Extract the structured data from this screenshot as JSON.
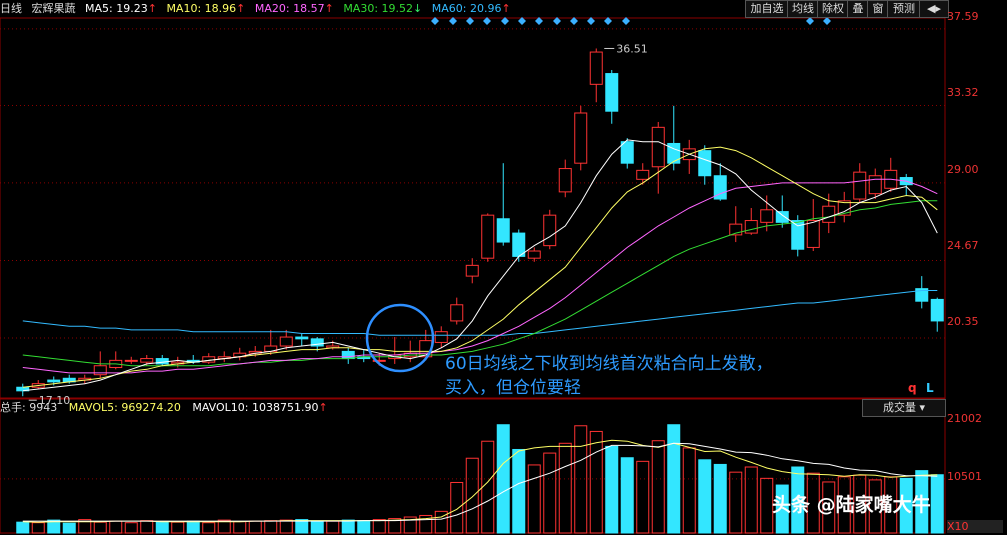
{
  "header": {
    "period": "日线",
    "stock_name": "宏辉果蔬",
    "ma5": {
      "label": "MA5: 19.23",
      "color": "#ffffff"
    },
    "ma10": {
      "label": "MA10: 18.96",
      "color": "#ffff66"
    },
    "ma20": {
      "label": "MA20: 18.57",
      "color": "#ff66ff"
    },
    "ma30": {
      "label": "MA30: 19.52",
      "color": "#33dd33"
    },
    "ma60": {
      "label": "MA60: 20.96",
      "color": "#33bbff"
    },
    "arrow_up": "↑",
    "arrow_down": "↓"
  },
  "toolbar": {
    "add_watch": "加自选",
    "ma": "均线",
    "adjust": "除权",
    "overlay": "叠",
    "window": "窗",
    "forecast": "预测",
    "menu_arrow": "◀▸"
  },
  "volume_header": {
    "total": "总手: 9943",
    "mavol5": "MAVOL5: 969274.20",
    "mavol10": "MAVOL10: 1038751.90",
    "selector": "成交量 ▾"
  },
  "annotation": {
    "line1": "60日均线之下收到均线首次粘合向上发散，",
    "line2": "买入，但仓位要轻"
  },
  "watermark": "头条 @陆家嘴大牛",
  "corner_letters": {
    "q": "q",
    "l": "L"
  },
  "colors": {
    "up": "#ff3333",
    "down": "#33e6ff",
    "background": "#000000",
    "grid": "#8b0000"
  },
  "chart_data": {
    "type": "candlestick",
    "price_axis_ticks": [
      "37.59",
      "33.32",
      "29.00",
      "24.67",
      "20.35"
    ],
    "price_range": [
      17.0,
      38.2
    ],
    "high_label": "36.51",
    "low_label": "17.10",
    "volume_axis_ticks": [
      "21002",
      "10501",
      "X10"
    ],
    "volume_range": [
      0,
      22500
    ],
    "candles": [
      {
        "o": 17.6,
        "c": 17.4,
        "h": 17.8,
        "l": 17.1
      },
      {
        "o": 17.6,
        "c": 17.8,
        "h": 18.0,
        "l": 17.5
      },
      {
        "o": 18.0,
        "c": 17.9,
        "h": 18.2,
        "l": 17.7
      },
      {
        "o": 18.1,
        "c": 17.9,
        "h": 18.3,
        "l": 17.8
      },
      {
        "o": 18.0,
        "c": 18.1,
        "h": 18.3,
        "l": 17.8
      },
      {
        "o": 18.3,
        "c": 18.8,
        "h": 19.6,
        "l": 18.1
      },
      {
        "o": 18.7,
        "c": 19.1,
        "h": 19.6,
        "l": 18.6
      },
      {
        "o": 19.1,
        "c": 19.1,
        "h": 19.3,
        "l": 18.9
      },
      {
        "o": 19.0,
        "c": 19.2,
        "h": 19.4,
        "l": 18.8
      },
      {
        "o": 19.2,
        "c": 18.9,
        "h": 19.4,
        "l": 18.8
      },
      {
        "o": 18.9,
        "c": 19.0,
        "h": 19.3,
        "l": 18.7
      },
      {
        "o": 19.1,
        "c": 19.0,
        "h": 19.4,
        "l": 18.9
      },
      {
        "o": 19.0,
        "c": 19.3,
        "h": 19.5,
        "l": 18.9
      },
      {
        "o": 19.2,
        "c": 19.3,
        "h": 19.6,
        "l": 19.0
      },
      {
        "o": 19.3,
        "c": 19.5,
        "h": 19.8,
        "l": 19.1
      },
      {
        "o": 19.5,
        "c": 19.6,
        "h": 19.9,
        "l": 19.3
      },
      {
        "o": 19.6,
        "c": 19.9,
        "h": 20.8,
        "l": 19.4
      },
      {
        "o": 19.9,
        "c": 20.4,
        "h": 20.8,
        "l": 19.7
      },
      {
        "o": 20.4,
        "c": 20.3,
        "h": 20.6,
        "l": 19.9
      },
      {
        "o": 20.3,
        "c": 19.9,
        "h": 20.4,
        "l": 19.6
      },
      {
        "o": 19.8,
        "c": 19.9,
        "h": 20.2,
        "l": 19.7
      },
      {
        "o": 19.6,
        "c": 19.2,
        "h": 19.8,
        "l": 18.9
      },
      {
        "o": 19.3,
        "c": 19.2,
        "h": 19.7,
        "l": 19.0
      },
      {
        "o": 19.1,
        "c": 19.1,
        "h": 19.5,
        "l": 18.8
      },
      {
        "o": 19.2,
        "c": 19.4,
        "h": 20.4,
        "l": 18.9
      },
      {
        "o": 19.3,
        "c": 19.5,
        "h": 20.2,
        "l": 19.0
      },
      {
        "o": 19.3,
        "c": 20.2,
        "h": 20.8,
        "l": 19.1
      },
      {
        "o": 20.1,
        "c": 20.7,
        "h": 21.0,
        "l": 19.8
      },
      {
        "o": 21.3,
        "c": 22.2,
        "h": 22.6,
        "l": 21.1
      },
      {
        "o": 23.8,
        "c": 24.4,
        "h": 24.8,
        "l": 23.4
      },
      {
        "o": 24.8,
        "c": 27.2,
        "h": 27.3,
        "l": 24.6
      },
      {
        "o": 27.0,
        "c": 25.7,
        "h": 30.1,
        "l": 25.5
      },
      {
        "o": 26.2,
        "c": 24.9,
        "h": 26.4,
        "l": 24.6
      },
      {
        "o": 24.8,
        "c": 25.2,
        "h": 25.4,
        "l": 24.6
      },
      {
        "o": 25.5,
        "c": 27.2,
        "h": 27.5,
        "l": 25.3
      },
      {
        "o": 28.5,
        "c": 29.8,
        "h": 30.3,
        "l": 28.2
      },
      {
        "o": 30.1,
        "c": 32.9,
        "h": 33.3,
        "l": 29.7
      },
      {
        "o": 34.5,
        "c": 36.3,
        "h": 36.5,
        "l": 33.5
      },
      {
        "o": 35.1,
        "c": 33.0,
        "h": 35.3,
        "l": 32.3
      },
      {
        "o": 31.3,
        "c": 30.1,
        "h": 31.5,
        "l": 29.8
      },
      {
        "o": 29.2,
        "c": 29.7,
        "h": 30.1,
        "l": 28.9
      },
      {
        "o": 29.9,
        "c": 32.1,
        "h": 32.4,
        "l": 28.4
      },
      {
        "o": 31.2,
        "c": 30.1,
        "h": 33.3,
        "l": 29.7
      },
      {
        "o": 30.3,
        "c": 30.9,
        "h": 31.4,
        "l": 29.5
      },
      {
        "o": 30.8,
        "c": 29.4,
        "h": 31.1,
        "l": 28.9
      },
      {
        "o": 29.4,
        "c": 28.1,
        "h": 30.1,
        "l": 28.0
      },
      {
        "o": 26.1,
        "c": 26.7,
        "h": 27.7,
        "l": 25.7
      },
      {
        "o": 26.2,
        "c": 26.9,
        "h": 27.6,
        "l": 26.1
      },
      {
        "o": 26.8,
        "c": 27.5,
        "h": 28.3,
        "l": 26.3
      },
      {
        "o": 27.4,
        "c": 26.8,
        "h": 28.3,
        "l": 26.5
      },
      {
        "o": 26.9,
        "c": 25.3,
        "h": 27.2,
        "l": 24.9
      },
      {
        "o": 25.4,
        "c": 26.9,
        "h": 28.1,
        "l": 25.2
      },
      {
        "o": 26.8,
        "c": 27.7,
        "h": 28.4,
        "l": 26.2
      },
      {
        "o": 27.2,
        "c": 28.0,
        "h": 28.5,
        "l": 26.8
      },
      {
        "o": 28.1,
        "c": 29.6,
        "h": 30.1,
        "l": 27.9
      },
      {
        "o": 28.4,
        "c": 29.4,
        "h": 29.8,
        "l": 28.1
      },
      {
        "o": 28.7,
        "c": 29.7,
        "h": 30.4,
        "l": 28.5
      },
      {
        "o": 29.3,
        "c": 28.9,
        "h": 29.5,
        "l": 28.3
      },
      {
        "o": 23.1,
        "c": 22.4,
        "h": 23.8,
        "l": 22.0
      },
      {
        "o": 22.5,
        "c": 21.3,
        "h": 22.6,
        "l": 20.7
      }
    ],
    "volumes": [
      2100,
      2000,
      2500,
      1900,
      2600,
      2100,
      2300,
      2000,
      2400,
      2200,
      2100,
      2300,
      2000,
      2500,
      2200,
      2300,
      2400,
      2500,
      2600,
      2200,
      2300,
      2500,
      2400,
      2600,
      2800,
      3100,
      3400,
      4200,
      9800,
      14500,
      17800,
      21002,
      16200,
      13200,
      15500,
      17400,
      20800,
      19700,
      16800,
      14600,
      13900,
      17900,
      21002,
      16500,
      14200,
      13300,
      11800,
      12800,
      10600,
      9300,
      12800,
      11600,
      9900,
      10900,
      11200,
      10300,
      10900,
      10600,
      12100,
      11300
    ],
    "ma5_values": [
      17.4,
      17.5,
      17.6,
      17.7,
      17.8,
      18.0,
      18.3,
      18.6,
      18.9,
      19.0,
      19.1,
      19.0,
      19.1,
      19.2,
      19.3,
      19.5,
      19.6,
      19.8,
      19.9,
      20.0,
      20.1,
      19.9,
      19.7,
      19.5,
      19.3,
      19.2,
      19.4,
      19.8,
      20.3,
      21.3,
      22.7,
      23.8,
      24.9,
      25.5,
      26.0,
      26.6,
      27.9,
      29.4,
      30.6,
      31.4,
      31.3,
      31.3,
      30.9,
      30.6,
      30.3,
      30.0,
      29.5,
      28.6,
      27.9,
      27.2,
      26.6,
      26.8,
      27.1,
      27.4,
      27.9,
      28.2,
      28.6,
      28.8,
      27.9,
      26.2
    ],
    "ma10_values": [
      17.6,
      17.7,
      17.8,
      17.9,
      18.0,
      18.1,
      18.3,
      18.5,
      18.6,
      18.8,
      18.9,
      19.0,
      19.1,
      19.2,
      19.3,
      19.4,
      19.5,
      19.6,
      19.7,
      19.7,
      19.8,
      19.8,
      19.7,
      19.7,
      19.6,
      19.6,
      19.6,
      19.6,
      19.8,
      20.2,
      20.8,
      21.4,
      22.2,
      22.9,
      23.6,
      24.3,
      25.4,
      26.5,
      27.6,
      28.5,
      29.0,
      29.6,
      30.2,
      30.6,
      30.9,
      31.0,
      30.8,
      30.4,
      29.9,
      29.4,
      28.9,
      28.4,
      28.0,
      27.9,
      27.9,
      27.9,
      28.1,
      28.3,
      28.2,
      27.5
    ],
    "ma20_values": [
      18.7,
      18.6,
      18.5,
      18.4,
      18.4,
      18.4,
      18.4,
      18.4,
      18.5,
      18.5,
      18.6,
      18.6,
      18.7,
      18.8,
      18.9,
      19.0,
      19.1,
      19.1,
      19.2,
      19.2,
      19.3,
      19.3,
      19.4,
      19.4,
      19.4,
      19.5,
      19.5,
      19.6,
      19.7,
      19.9,
      20.2,
      20.6,
      21.0,
      21.5,
      22.0,
      22.6,
      23.3,
      24.0,
      24.7,
      25.4,
      26.0,
      26.6,
      27.1,
      27.6,
      28.0,
      28.4,
      28.7,
      28.8,
      28.9,
      29.0,
      29.0,
      29.0,
      29.0,
      29.0,
      29.1,
      29.2,
      29.2,
      29.1,
      28.8,
      28.4
    ],
    "ma30_values": [
      19.4,
      19.3,
      19.2,
      19.1,
      19.0,
      18.9,
      18.9,
      18.8,
      18.8,
      18.8,
      18.8,
      18.8,
      18.8,
      18.9,
      18.9,
      19.0,
      19.0,
      19.1,
      19.1,
      19.2,
      19.2,
      19.2,
      19.3,
      19.3,
      19.3,
      19.4,
      19.4,
      19.4,
      19.5,
      19.6,
      19.8,
      20.0,
      20.3,
      20.6,
      21.0,
      21.4,
      21.9,
      22.4,
      22.9,
      23.4,
      23.9,
      24.4,
      24.9,
      25.3,
      25.6,
      25.9,
      26.2,
      26.4,
      26.6,
      26.7,
      26.8,
      27.0,
      27.1,
      27.3,
      27.5,
      27.6,
      27.8,
      27.9,
      28.0,
      28.0
    ],
    "ma60_values": [
      21.3,
      21.2,
      21.1,
      21.0,
      21.0,
      20.9,
      20.9,
      20.8,
      20.8,
      20.8,
      20.8,
      20.7,
      20.7,
      20.7,
      20.7,
      20.7,
      20.7,
      20.7,
      20.6,
      20.6,
      20.6,
      20.6,
      20.6,
      20.5,
      20.5,
      20.5,
      20.5,
      20.5,
      20.5,
      20.5,
      20.5,
      20.5,
      20.6,
      20.6,
      20.7,
      20.8,
      20.9,
      21.0,
      21.1,
      21.2,
      21.3,
      21.4,
      21.5,
      21.6,
      21.7,
      21.8,
      21.9,
      22.0,
      22.1,
      22.2,
      22.3,
      22.3,
      22.4,
      22.5,
      22.6,
      22.7,
      22.8,
      22.9,
      23.0,
      23.0
    ],
    "mavol5_values": [
      2200,
      2100,
      2200,
      2200,
      2200,
      2200,
      2300,
      2300,
      2300,
      2200,
      2200,
      2200,
      2200,
      2200,
      2200,
      2300,
      2300,
      2400,
      2400,
      2400,
      2400,
      2400,
      2400,
      2400,
      2500,
      2600,
      2800,
      3100,
      4600,
      7000,
      9900,
      13500,
      15900,
      16500,
      16800,
      16800,
      16800,
      17500,
      18000,
      17800,
      17000,
      16600,
      17400,
      16600,
      15800,
      15900,
      14700,
      13700,
      12600,
      11900,
      11500,
      11400,
      11300,
      11000,
      11300,
      11200,
      10800,
      11000,
      11200,
      11300
    ],
    "mavol10_values": [
      2300,
      2300,
      2300,
      2300,
      2300,
      2300,
      2300,
      2300,
      2300,
      2300,
      2300,
      2300,
      2300,
      2300,
      2300,
      2300,
      2300,
      2300,
      2300,
      2300,
      2300,
      2300,
      2400,
      2400,
      2400,
      2500,
      2600,
      2700,
      3500,
      4700,
      6200,
      8000,
      9600,
      10600,
      11600,
      12900,
      14100,
      15700,
      17000,
      17000,
      16900,
      16700,
      17400,
      17300,
      16800,
      16300,
      15700,
      15600,
      15100,
      14400,
      14000,
      13500,
      13300,
      12600,
      12200,
      12100,
      11500,
      11100,
      11100,
      11000
    ],
    "markers_diamond_index": [
      27,
      28,
      29,
      30,
      31,
      32,
      33,
      34,
      35,
      36,
      45,
      46
    ],
    "markers_diamond_xpx": [
      435,
      453,
      470,
      487,
      505,
      522,
      539,
      557,
      574,
      591,
      608,
      626,
      810,
      827
    ]
  }
}
